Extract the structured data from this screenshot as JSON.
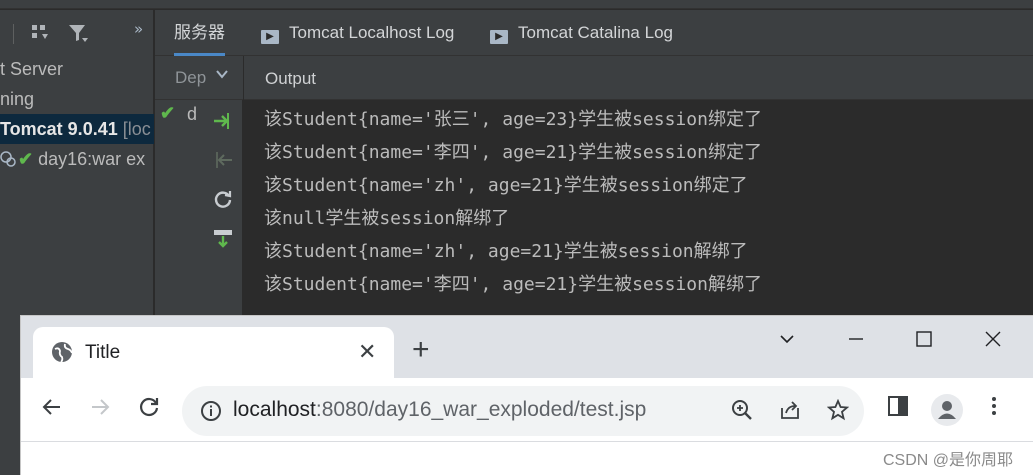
{
  "ide": {
    "tabs": [
      {
        "label": "服务器",
        "active": true
      },
      {
        "label": "Tomcat Localhost Log",
        "icon": "console-tab-icon"
      },
      {
        "label": "Tomcat Catalina Log",
        "icon": "console-tab-icon"
      }
    ],
    "tree": [
      {
        "label": "t Server"
      },
      {
        "label": "ning"
      },
      {
        "label_main": "Tomcat 9.0.41",
        "label_dim": "[loc"
      },
      {
        "label": "day16:war ex"
      }
    ],
    "deploy_header": "Dep",
    "deploy_item": "d",
    "output_label": "Output",
    "output_lines": [
      "该Student{name='张三', age=23}学生被session绑定了",
      "该Student{name='李四', age=21}学生被session绑定了",
      "该Student{name='zh', age=21}学生被session绑定了",
      "该null学生被session解绑了",
      "该Student{name='zh', age=21}学生被session解绑了",
      "该Student{name='李四', age=21}学生被session解绑了"
    ],
    "colors": {
      "accent": "#4a88c7",
      "success": "#5fb84d",
      "panel": "#3c3f41",
      "editor": "#2b2b2b"
    }
  },
  "browser": {
    "tab_title": "Title",
    "url_host": "localhost",
    "url_rest": ":8080/day16_war_exploded/test.jsp",
    "window_controls": [
      "chevron-down-icon",
      "minimize-icon",
      "maximize-icon",
      "close-icon"
    ]
  },
  "watermark": "CSDN @是你周耶"
}
